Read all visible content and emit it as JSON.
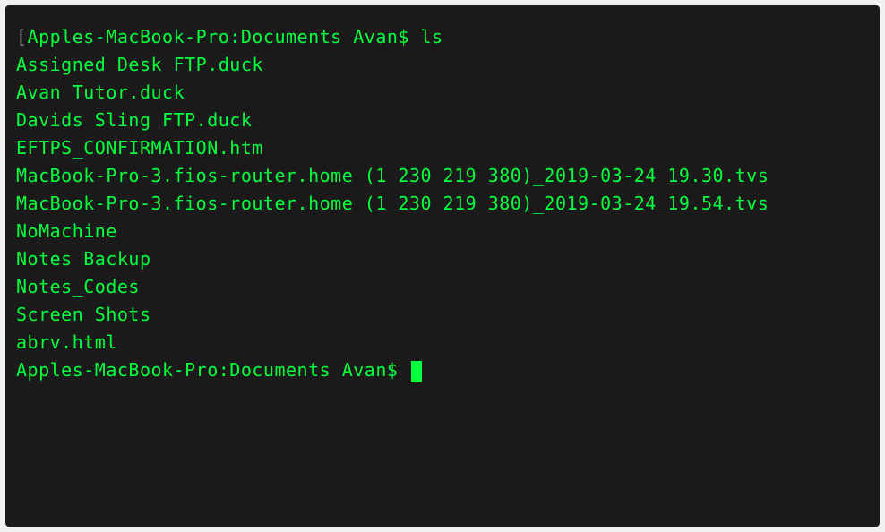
{
  "terminal": {
    "prompt_line1": {
      "bracket": "[",
      "host_path": "Apples-MacBook-Pro:Documents Avan$ ",
      "command": "ls"
    },
    "output": [
      "Assigned Desk FTP.duck",
      "Avan Tutor.duck",
      "Davids Sling FTP.duck",
      "EFTPS_CONFIRMATION.htm",
      "MacBook-Pro-3.fios-router.home (1 230 219 380)_2019-03-24 19.30.tvs",
      "MacBook-Pro-3.fios-router.home (1 230 219 380)_2019-03-24 19.54.tvs",
      "NoMachine",
      "Notes Backup",
      "Notes_Codes",
      "Screen Shots",
      "abrv.html"
    ],
    "prompt_line2": {
      "host_path": "Apples-MacBook-Pro:Documents Avan$ "
    }
  }
}
